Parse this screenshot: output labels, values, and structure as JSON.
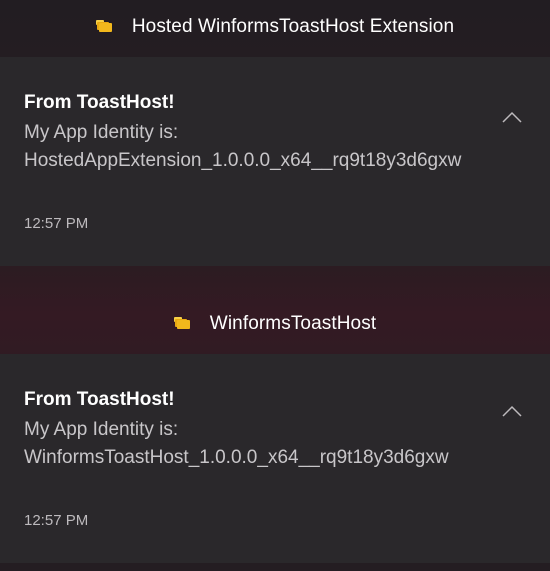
{
  "groups": [
    {
      "app_name": "Hosted WinformsToastHost Extension",
      "app_icon": "folder-app-icon",
      "notification": {
        "title": "From ToastHost!",
        "line1": "My App Identity is:",
        "line2": "HostedAppExtension_1.0.0.0_x64__rq9t18y3d6gxw",
        "time": "12:57 PM"
      }
    },
    {
      "app_name": "WinformsToastHost",
      "app_icon": "folder-app-icon",
      "notification": {
        "title": "From ToastHost!",
        "line1": "My App Identity is:",
        "line2": "WinformsToastHost_1.0.0.0_x64__rq9t18y3d6gxw",
        "time": "12:57 PM"
      }
    }
  ],
  "icons": {
    "collapse": "chevron-up-icon"
  }
}
